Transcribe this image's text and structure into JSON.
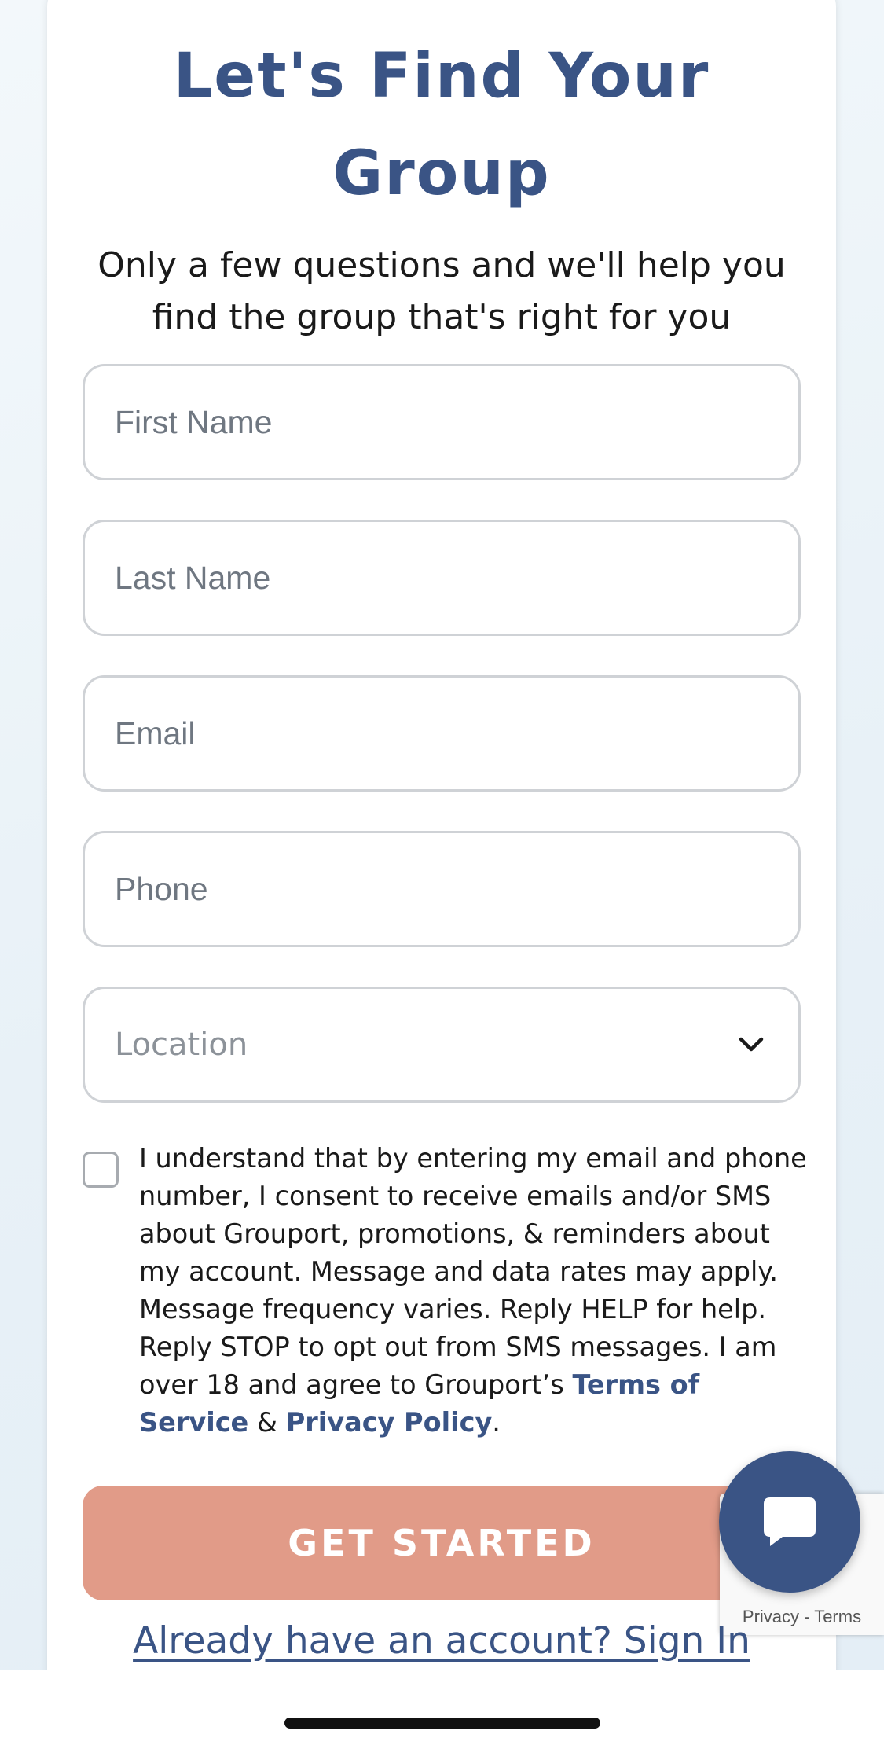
{
  "form": {
    "title_line1": "Let's Find Your",
    "title_line2": "Group",
    "subtitle_line1": "Only a few questions and we'll help you",
    "subtitle_line2": "find the group that's right for you",
    "fields": {
      "first_name": "First Name",
      "last_name": "Last Name",
      "email": "Email",
      "phone": "Phone",
      "location": "Location"
    },
    "consent": {
      "text": "I understand that by entering my email and phone number, I consent to receive emails and/or SMS about Grouport, promotions, & reminders about my account. Message and data rates may apply. Message frequency varies. Reply HELP for help. Reply STOP to opt out from SMS messages. I am over 18 and agree to Grouport’s ",
      "terms_link": "Terms of Service",
      "amp": " & ",
      "privacy_link": "Privacy Policy",
      "end": "."
    },
    "submit_label": "GET STARTED",
    "signin_link": "Already have an account? Sign In"
  },
  "recaptcha": {
    "privacy": "Privacy",
    "sep": " - ",
    "terms": "Terms"
  },
  "colors": {
    "brand_blue": "#3a5485",
    "button_salmon": "#e19b88"
  }
}
